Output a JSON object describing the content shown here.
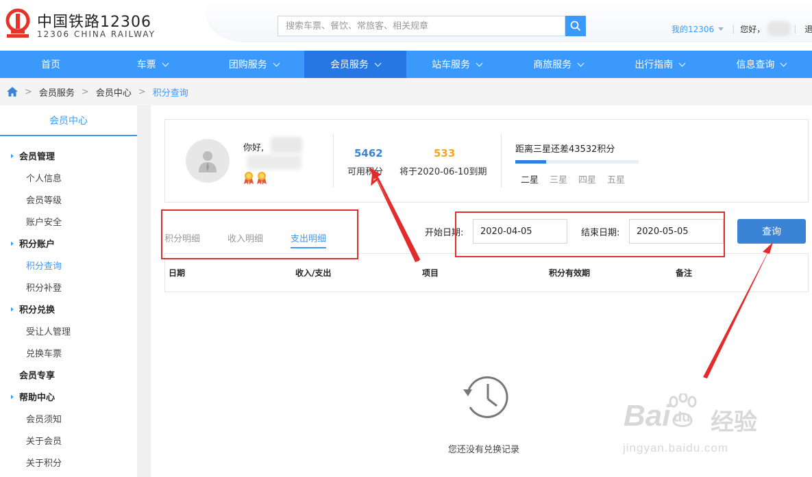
{
  "header": {
    "logo_title": "中国铁路12306",
    "logo_sub": "12306 CHINA RAILWAY",
    "search_placeholder": "搜索车票、餐饮、常旅客、相关规章",
    "my12306": "我的12306",
    "hello": "您好，",
    "logout": "退出"
  },
  "nav": [
    {
      "label": "首页",
      "caret": false,
      "active": false
    },
    {
      "label": "车票",
      "caret": true,
      "active": false
    },
    {
      "label": "团购服务",
      "caret": true,
      "active": false
    },
    {
      "label": "会员服务",
      "caret": true,
      "active": true
    },
    {
      "label": "站车服务",
      "caret": true,
      "active": false
    },
    {
      "label": "商旅服务",
      "caret": true,
      "active": false
    },
    {
      "label": "出行指南",
      "caret": true,
      "active": false
    },
    {
      "label": "信息查询",
      "caret": true,
      "active": false
    }
  ],
  "breadcrumb": {
    "items": [
      "会员服务",
      "会员中心"
    ],
    "current": "积分查询",
    "separator": ">"
  },
  "sidebar": {
    "title": "会员中心",
    "groups": [
      {
        "label": "会员管理",
        "items": [
          "个人信息",
          "会员等级",
          "账户安全"
        ]
      },
      {
        "label": "积分账户",
        "items": [
          "积分查询",
          "积分补登"
        ]
      },
      {
        "label": "积分兑换",
        "items": [
          "受让人管理",
          "兑换车票"
        ]
      },
      {
        "label": "会员专享",
        "items": []
      },
      {
        "label": "帮助中心",
        "items": [
          "会员须知",
          "关于会员",
          "关于积分"
        ]
      }
    ],
    "active_item": "积分查询"
  },
  "profile": {
    "greeting": "你好,",
    "available_points": "5462",
    "available_label": "可用积分",
    "expiring_points": "533",
    "expiring_label": "将于2020-06-10到期",
    "star_text": "距离三星还差43532积分",
    "progress": 0.25,
    "levels": [
      "二星",
      "三星",
      "四星",
      "五星"
    ],
    "current_level": "二星"
  },
  "tabs": [
    {
      "label": "积分明细",
      "active": false
    },
    {
      "label": "收入明细",
      "active": false
    },
    {
      "label": "支出明细",
      "active": true
    }
  ],
  "filters": {
    "start_label": "开始日期:",
    "start_value": "2020-04-05",
    "end_label": "结束日期:",
    "end_value": "2020-05-05",
    "query_label": "查询"
  },
  "table": {
    "headers": [
      "日期",
      "收入/支出",
      "项目",
      "积分有效期",
      "备注"
    ]
  },
  "empty": {
    "text": "您还没有兑换记录"
  },
  "watermark": {
    "brand": "Bai",
    "brand2": "du",
    "cn": "经验",
    "url": "jingyan.baidu.com"
  },
  "colors": {
    "primary": "#3b99fc",
    "nav_active": "#2676e3",
    "points_blue": "#3b83d4",
    "points_gold": "#f0a91c",
    "annotation_red": "#e22b2b"
  }
}
